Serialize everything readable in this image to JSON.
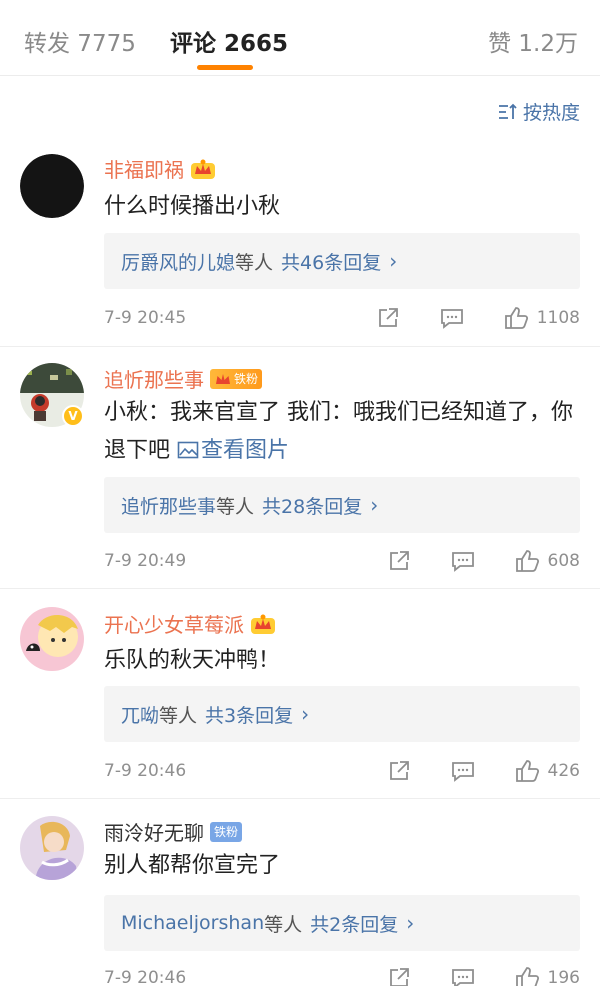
{
  "tabs": [
    {
      "label": "转发 7775"
    },
    {
      "label": "评论 2665"
    },
    {
      "label": "赞 1.2万"
    }
  ],
  "sort": {
    "label": "按热度"
  },
  "colors": {
    "accent": "#ff8200",
    "username": "#eb7350",
    "link": "#4a74a8"
  },
  "comments": [
    {
      "username": "非福即祸",
      "text": "什么时候播出小秋",
      "reply_names": "厉爵风的儿媳",
      "reply_mid": "等人",
      "reply_count": "共46条回复",
      "timestamp": "7-9 20:45",
      "likes": "1108"
    },
    {
      "username": "追忻那些事",
      "fan_badge": "铁粉",
      "text": "小秋：我来官宣了 我们：哦我们已经知道了，你退下吧 ",
      "image_link": "查看图片",
      "reply_names": "追忻那些事",
      "reply_mid": "等人",
      "reply_count": "共28条回复",
      "timestamp": "7-9 20:49",
      "likes": "608"
    },
    {
      "username": "开心少女草莓派",
      "text": "乐队的秋天冲鸭！",
      "reply_names": "兀呦",
      "reply_mid": "等人",
      "reply_count": "共3条回复",
      "timestamp": "7-9 20:46",
      "likes": "426"
    },
    {
      "username": "雨泠好无聊",
      "fan_badge": "铁粉",
      "text": "别人都帮你宣完了",
      "reply_names": "Michaeljorshan",
      "reply_mid": "等人",
      "reply_count": "共2条回复",
      "timestamp": "7-9 20:46",
      "likes": "196"
    }
  ]
}
